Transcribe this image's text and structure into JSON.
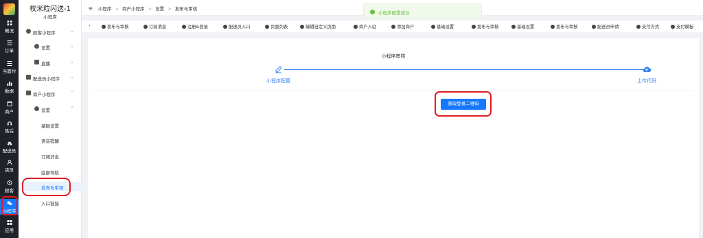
{
  "rail": {
    "items": [
      {
        "label": "概况",
        "icon": "overview-icon"
      },
      {
        "label": "订单",
        "icon": "order-icon"
      },
      {
        "label": "当面付",
        "icon": "pay-icon"
      },
      {
        "label": "数据",
        "icon": "data-icon"
      },
      {
        "label": "商户",
        "icon": "shop-icon"
      },
      {
        "label": "售后",
        "icon": "headset-icon"
      },
      {
        "label": "配送员",
        "icon": "courier-icon"
      },
      {
        "label": "店员",
        "icon": "clerk-icon"
      },
      {
        "label": "顾客",
        "icon": "customer-icon"
      },
      {
        "label": "小程序",
        "icon": "wechat-icon"
      },
      {
        "label": "应用",
        "icon": "apps-icon"
      }
    ],
    "active_index": 9
  },
  "sidebar": {
    "store_name": "校米粒闪送-1",
    "subtitle": "小程序",
    "rows": [
      {
        "label": "顾客小程序",
        "chevron": "⌄"
      },
      {
        "label": "设置",
        "chevron": "⌄"
      },
      {
        "label": "直播",
        "chevron": "⌄"
      },
      {
        "label": "配送员小程序",
        "chevron": "⌄"
      },
      {
        "label": "商户小程序",
        "chevron": "⌃"
      },
      {
        "label": "设置",
        "chevron": "⌃"
      },
      {
        "label": "基础设置"
      },
      {
        "label": "语音提醒"
      },
      {
        "label": "订阅消息"
      },
      {
        "label": "底部导航"
      },
      {
        "label": "发布与审核"
      },
      {
        "label": "入口链接"
      }
    ]
  },
  "breadcrumb": {
    "menu_icon": "☰",
    "items": [
      "小程序",
      "商户小程序",
      "设置",
      "发布与审核"
    ],
    "sep": ">"
  },
  "toast": {
    "message": "小程序配置成功",
    "color": "#67c23a"
  },
  "tabs": {
    "back": "‹",
    "items": [
      "发布与审核",
      "订阅消息",
      "注册&登录",
      "配送员入口",
      "页面列表",
      "编辑自定义页面",
      "商户入驻",
      "添加商户",
      "基础设置",
      "发布与审核",
      "基础设置",
      "发布与审核",
      "配送员申请",
      "支付方式",
      "支付模板"
    ]
  },
  "main": {
    "section_title": "小程序审核",
    "step1": "小程序配置",
    "step2": "上传代码",
    "button": "获取登录二维码"
  },
  "colors": {
    "accent": "#1677ff",
    "highlight": "#e01b24",
    "rail": "#1f2329"
  }
}
